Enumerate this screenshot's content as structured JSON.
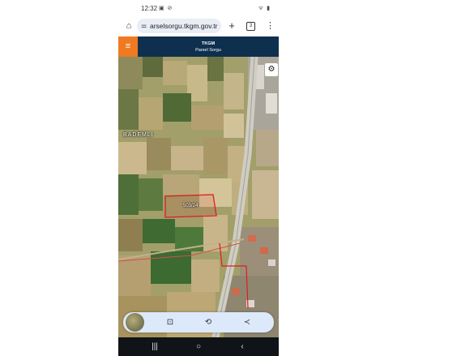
{
  "status_bar": {
    "time": "12:32",
    "left_icons": "▣ ⊘",
    "right_icons": "ᯤ ▮"
  },
  "browser": {
    "url": "arselsorgu.tkgm.gov.tr",
    "tabs_count": "3"
  },
  "app_header": {
    "title": "TKGM",
    "subtitle": "Parsel Sorgu"
  },
  "map": {
    "village_label": "BADEMLI",
    "parcel_label": "503/24",
    "colors": {
      "parcel_outline": "#e01c1c",
      "road": "#c9c7bd"
    }
  },
  "icons": {
    "home": "home-icon",
    "tune": "tune-icon",
    "plus": "plus-icon",
    "tabs": "tabs-icon",
    "menu": "more-vert-icon",
    "hamburger": "hamburger-icon",
    "settings": "gear-icon",
    "lens": "lens-icon",
    "translate": "translate-icon",
    "share": "share-icon"
  },
  "nav": {
    "recent": "|||",
    "home": "○",
    "back": "‹"
  }
}
